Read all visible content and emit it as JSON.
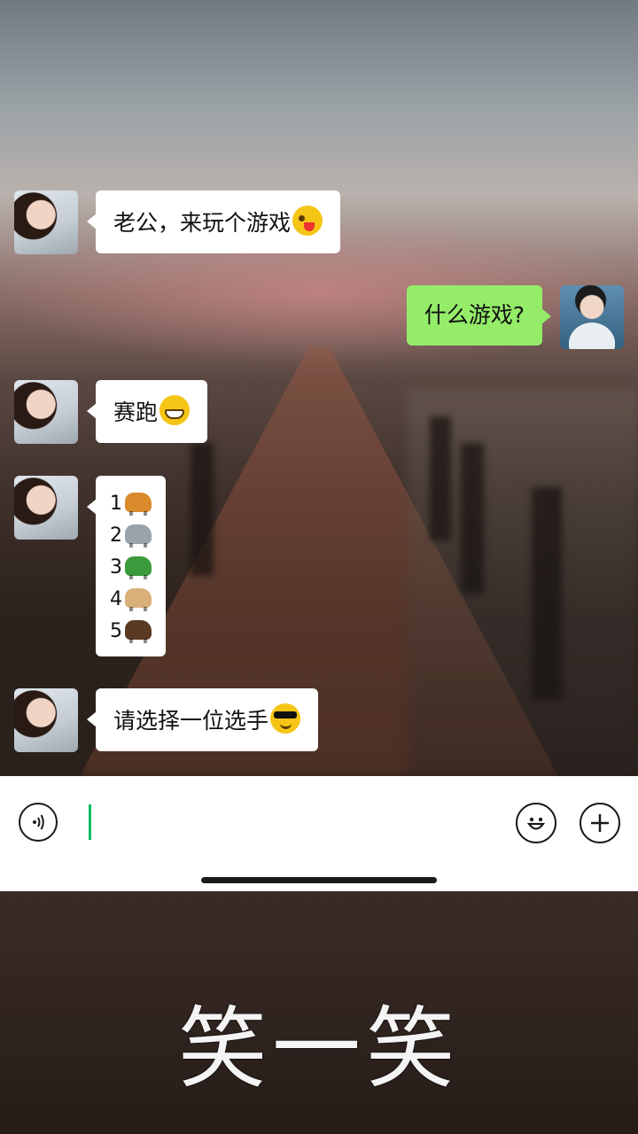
{
  "chat": {
    "messages": [
      {
        "sender": "girlfriend",
        "text": "老公，来玩个游戏",
        "emoji": "winking-tongue-emoji"
      },
      {
        "sender": "me",
        "text": "什么游戏?"
      },
      {
        "sender": "girlfriend",
        "text": "赛跑",
        "emoji": "grinning-emoji"
      },
      {
        "sender": "girlfriend",
        "list": [
          {
            "num": "1",
            "animal": "tiger",
            "color": "#d98a2b"
          },
          {
            "num": "2",
            "animal": "elephant",
            "color": "#9aa3ab"
          },
          {
            "num": "3",
            "animal": "turtle",
            "color": "#3b9a3b"
          },
          {
            "num": "4",
            "animal": "dog",
            "color": "#d9b07a"
          },
          {
            "num": "5",
            "animal": "racehorse",
            "color": "#5a3a22"
          }
        ]
      },
      {
        "sender": "girlfriend",
        "text": "请选择一位选手",
        "emoji": "sunglasses-emoji"
      }
    ]
  },
  "input_bar": {
    "voice_icon": "voice-icon",
    "emoji_icon": "smile-icon",
    "more_icon": "plus-icon"
  },
  "caption": "笑一笑",
  "colors": {
    "sent_bubble": "#95ec69",
    "received_bubble": "#ffffff",
    "caret": "#07c160"
  }
}
